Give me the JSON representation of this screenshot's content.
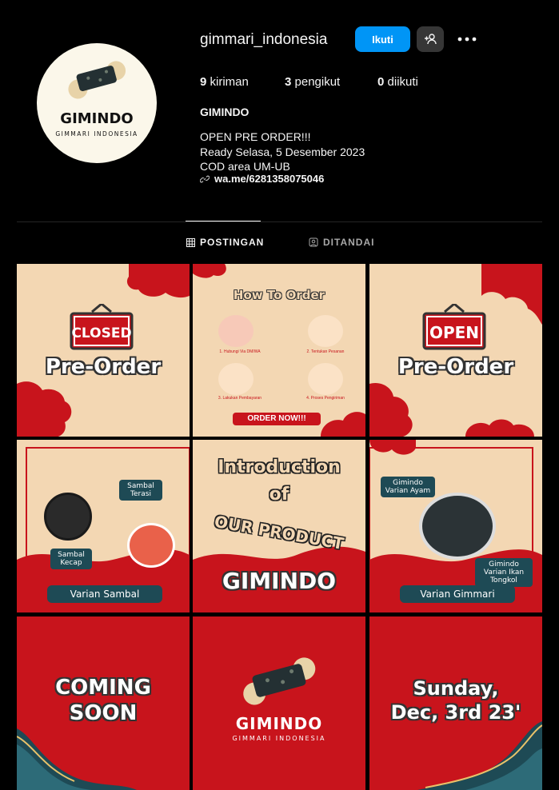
{
  "profile": {
    "username": "gimmari_indonesia",
    "follow_label": "Ikuti",
    "stats": {
      "posts_count": "9",
      "posts_label": "kiriman",
      "followers_count": "3",
      "followers_label": "pengikut",
      "following_count": "0",
      "following_label": "diikuti"
    },
    "full_name": "GIMINDO",
    "bio_lines": [
      "OPEN PRE ORDER!!!",
      "Ready Selasa, 5 Desember 2023",
      "COD area UM-UB"
    ],
    "link": "wa.me/6281358075046",
    "avatar": {
      "brand": "GIMINDO",
      "subtitle": "GIMMARI INDONESIA"
    }
  },
  "tabs": [
    {
      "label": "POSTINGAN",
      "icon": "grid-icon",
      "active": true
    },
    {
      "label": "DITANDAI",
      "icon": "tagged-icon",
      "active": false
    }
  ],
  "colors": {
    "accent": "#0095f6",
    "tile_cream": "#f3d7b3",
    "tile_red": "#c8141c",
    "dark_teal": "#1e4a55"
  },
  "posts": [
    {
      "sign": "CLOSED",
      "title": "Pre-Order"
    },
    {
      "title": "How To Order",
      "steps": [
        "1. Hubungi Via DM/WA",
        "2. Tentukan Pesanan",
        "3. Lakukan Pembayaran",
        "4. Proses Pengiriman"
      ],
      "cta": "ORDER NOW!!!"
    },
    {
      "sign": "OPEN",
      "title": "Pre-Order"
    },
    {
      "labels": [
        "Sambal Terasi",
        "Sambal Kecap"
      ],
      "caption": "Varian Sambal"
    },
    {
      "line1": "Introduction",
      "line2": "of",
      "line3": "OUR PRODUCT",
      "brand": "GIMINDO"
    },
    {
      "labels": [
        "Gimindo Varian Ayam",
        "Gimindo Varian Ikan Tongkol"
      ],
      "caption": "Varian Gimmari"
    },
    {
      "line1": "COMING",
      "line2": "SOON"
    },
    {
      "brand": "GIMINDO",
      "subtitle": "GIMMARI INDONESIA"
    },
    {
      "line1": "Sunday,",
      "line2": "Dec, 3rd 23'"
    }
  ]
}
